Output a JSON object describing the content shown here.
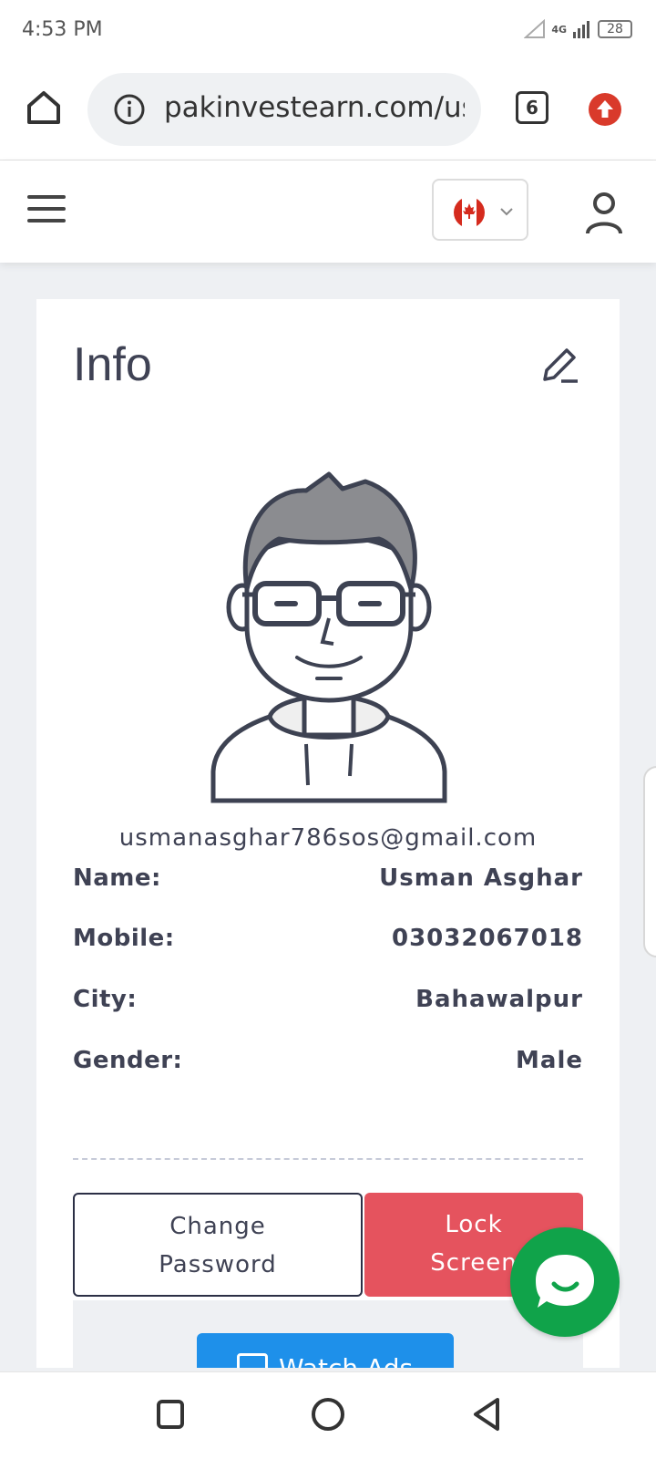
{
  "status_bar": {
    "time": "4:53 PM",
    "network": "4G",
    "battery": "28"
  },
  "browser": {
    "url": "pakinvestearn.com/user",
    "tab_count": "6"
  },
  "header": {
    "language_flag": "canada-flag-icon"
  },
  "profile": {
    "title": "Info",
    "email": "usmanasghar786sos@gmail.com",
    "fields": [
      {
        "label": "Name:",
        "value": "Usman Asghar"
      },
      {
        "label": "Mobile:",
        "value": "03032067018"
      },
      {
        "label": "City:",
        "value": "Bahawalpur"
      },
      {
        "label": "Gender:",
        "value": "Male"
      }
    ],
    "change_password_line1": "Change",
    "change_password_line2": "Password",
    "lock_screen_line1": "Lock",
    "lock_screen_line2": "Screen",
    "watch_ads_label": "Watch Ads"
  },
  "colors": {
    "accent_red": "#e5535e",
    "accent_blue": "#1e90ea",
    "chat_green": "#10a34a",
    "text": "#3f4254"
  }
}
